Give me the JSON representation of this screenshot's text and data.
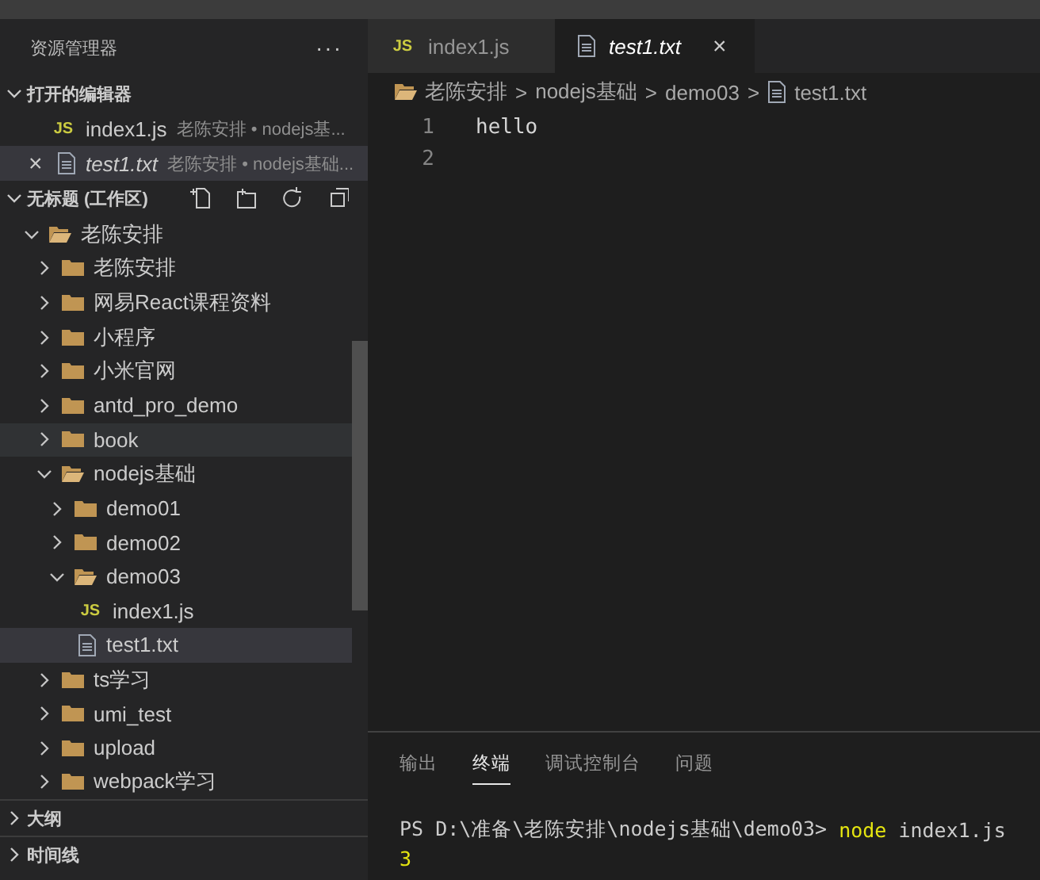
{
  "sidebar": {
    "title": "资源管理器",
    "more": "···",
    "open_editors": {
      "title": "打开的编辑器",
      "expanded": true,
      "items": [
        {
          "kind": "js",
          "badge": "JS",
          "name": "index1.js",
          "path": "老陈安排 • nodejs基...",
          "italic": false,
          "selected": false
        },
        {
          "kind": "txt",
          "name": "test1.txt",
          "path": "老陈安排 • nodejs基础...",
          "italic": true,
          "selected": true,
          "close": "×"
        }
      ]
    },
    "workspace": {
      "title": "无标题 (工作区)",
      "expanded": true,
      "tree": [
        {
          "kind": "folder",
          "name": "老陈安排",
          "expanded": true,
          "selected": false,
          "children": [
            {
              "kind": "folder",
              "name": "老陈安排",
              "expanded": false,
              "selected": false
            },
            {
              "kind": "folder",
              "name": "网易React课程资料",
              "expanded": false,
              "selected": false
            },
            {
              "kind": "folder",
              "name": "小程序",
              "expanded": false,
              "selected": false
            },
            {
              "kind": "folder",
              "name": "小米官网",
              "expanded": false,
              "selected": false
            },
            {
              "kind": "folder",
              "name": "antd_pro_demo",
              "expanded": false,
              "selected": false
            },
            {
              "kind": "folder",
              "name": "book",
              "expanded": false,
              "selected": false,
              "hovered": true
            },
            {
              "kind": "folder",
              "name": "nodejs基础",
              "expanded": true,
              "selected": false,
              "children": [
                {
                  "kind": "folder",
                  "name": "demo01",
                  "expanded": false,
                  "selected": false
                },
                {
                  "kind": "folder",
                  "name": "demo02",
                  "expanded": false,
                  "selected": false
                },
                {
                  "kind": "folder",
                  "name": "demo03",
                  "expanded": true,
                  "selected": false,
                  "children": [
                    {
                      "kind": "js",
                      "badge": "JS",
                      "name": "index1.js",
                      "selected": false
                    },
                    {
                      "kind": "txt",
                      "name": "test1.txt",
                      "selected": true
                    }
                  ]
                }
              ]
            },
            {
              "kind": "folder",
              "name": "ts学习",
              "expanded": false,
              "selected": false
            },
            {
              "kind": "folder",
              "name": "umi_test",
              "expanded": false,
              "selected": false
            },
            {
              "kind": "folder",
              "name": "upload",
              "expanded": false,
              "selected": false
            },
            {
              "kind": "folder",
              "name": "webpack学习",
              "expanded": false,
              "selected": false
            }
          ]
        }
      ]
    },
    "sections": [
      {
        "title": "大纲",
        "expanded": false
      },
      {
        "title": "时间线",
        "expanded": false
      }
    ]
  },
  "tabs": [
    {
      "kind": "js",
      "badge": "JS",
      "label": "index1.js",
      "italic": false,
      "selected": false
    },
    {
      "kind": "txt",
      "label": "test1.txt",
      "italic": true,
      "selected": true,
      "close": "×"
    }
  ],
  "breadcrumb": [
    {
      "kind": "folder",
      "label": "老陈安排"
    },
    {
      "kind": "text",
      "label": "nodejs基础"
    },
    {
      "kind": "text",
      "label": "demo03"
    },
    {
      "kind": "txt",
      "label": "test1.txt"
    }
  ],
  "breadcrumb_separator": ">",
  "editor": {
    "lines": [
      {
        "number": "1",
        "text": "hello"
      },
      {
        "number": "2"
      }
    ]
  },
  "panel": {
    "tabs": [
      {
        "label": "输出",
        "selected": false
      },
      {
        "label": "终端",
        "selected": true
      },
      {
        "label": "调试控制台",
        "selected": false
      },
      {
        "label": "问题",
        "selected": false
      }
    ],
    "terminal": [
      [
        {
          "kind": "prompt",
          "text": "PS D:\\准备\\老陈安排\\nodejs基础\\demo03> "
        },
        {
          "kind": "command",
          "text": "node"
        },
        {
          "kind": "plain",
          "text": " index1.js"
        }
      ],
      [
        {
          "kind": "output",
          "text": "3"
        }
      ]
    ]
  }
}
